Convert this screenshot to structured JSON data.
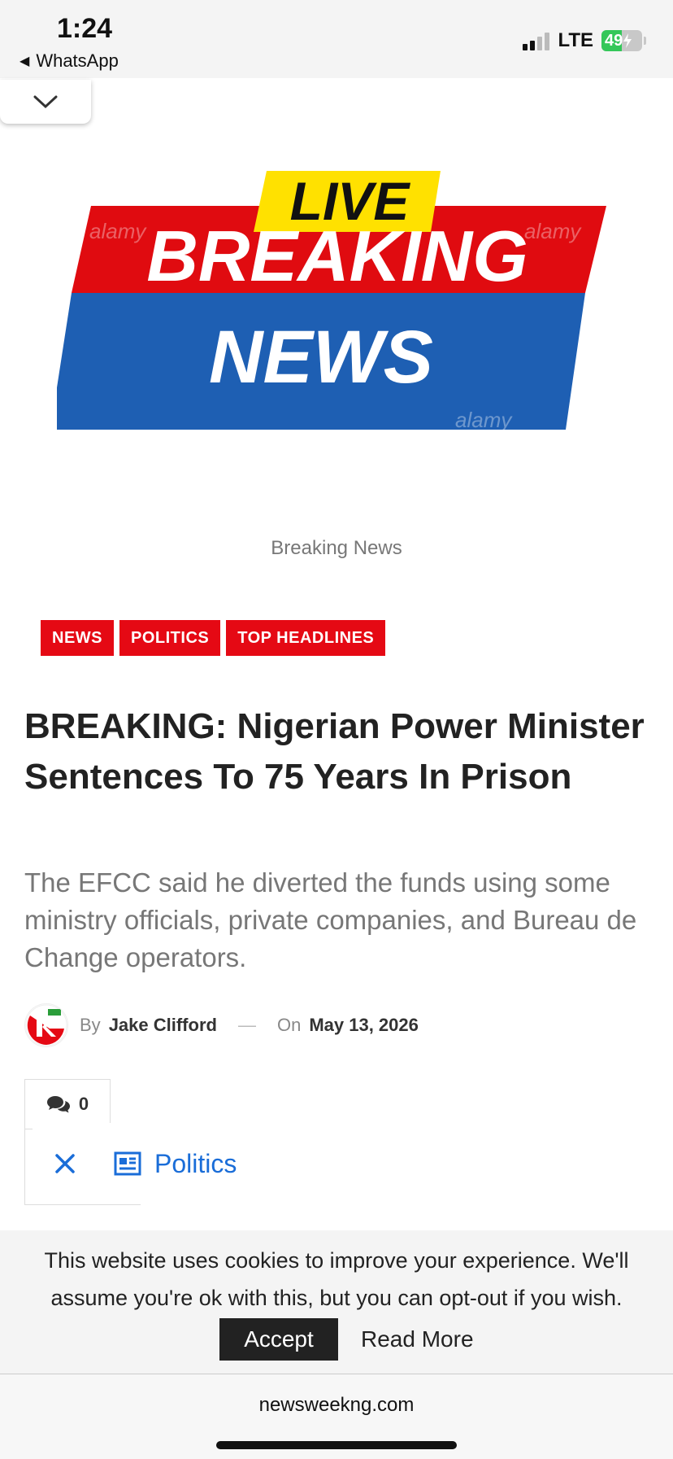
{
  "status_bar": {
    "time": "1:24",
    "back_app": "WhatsApp",
    "network": "LTE",
    "battery": "49",
    "battery_level_percent": 49
  },
  "hero": {
    "badge": "LIVE",
    "line1": "BREAKING",
    "line2": "NEWS",
    "watermark": "alamy",
    "colors": {
      "yellow": "#ffe100",
      "red": "#e00b10",
      "blue": "#1e5fb3"
    }
  },
  "caption": "Breaking News",
  "tags": [
    "NEWS",
    "POLITICS",
    "TOP HEADLINES"
  ],
  "article": {
    "headline": "BREAKING: Nigerian Power Minister Sentences To 75 Years In Prison",
    "excerpt": "The EFCC said he diverted the funds using some ministry officials, private companies, and Bureau de Change operators.",
    "by_label": "By",
    "author": "Jake Clifford",
    "dash": "—",
    "on_label": "On",
    "date": "May 13, 2026",
    "comment_count": "0",
    "category": "Politics"
  },
  "cookie_bar": {
    "text": "This website uses cookies to improve your experience. We'll assume you're ok with this, but you can opt-out if you wish.",
    "accept_label": "Accept",
    "read_more_label": "Read More"
  },
  "browser": {
    "url": "newsweekng.com"
  },
  "colors": {
    "tag_red": "#e50914",
    "link_blue": "#1a6dd8"
  }
}
